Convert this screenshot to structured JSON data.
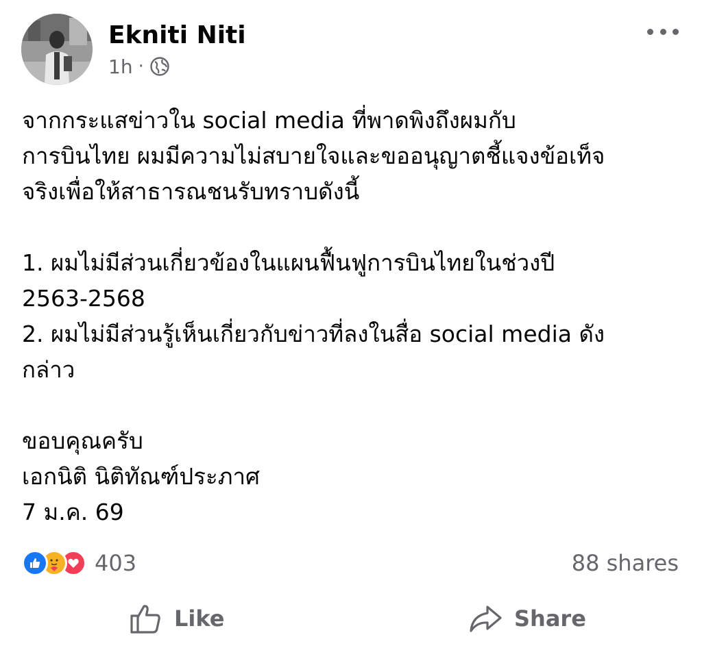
{
  "post": {
    "author": "Ekniti Niti",
    "time": "1h",
    "separator": "·",
    "privacy_icon": "globe-icon",
    "more_icon": "more-icon",
    "body": {
      "para1": "จากกระแสข่าวใน social media ที่พาดพิงถึงผมกับ\nการบินไทย ผมมีความไม่สบายใจและขออนุญาตชี้แจงข้อเท็จ\nจริงเพื่อให้สาธารณชนรับทราบดังนี้",
      "item1": "1. ผมไม่มีส่วนเกี่ยวข้องในแผนฟื้นฟูการบินไทยในช่วงปี\n2563-2568",
      "item2": "2. ผมไม่มีส่วนรู้เห็นเกี่ยวกับข่าวที่ลงในสื่อ social media ดัง\nกล่าว",
      "thanks": "ขอบคุณครับ",
      "signature": "เอกนิติ นิติทัณฑ์ประภาศ",
      "date": "7 ม.ค. 69"
    }
  },
  "stats": {
    "reaction_icons": [
      "like-reaction-icon",
      "care-reaction-icon",
      "love-reaction-icon"
    ],
    "reaction_count": "403",
    "shares": "88 shares"
  },
  "actions": {
    "like_label": "Like",
    "share_label": "Share"
  },
  "colors": {
    "text": "#050505",
    "secondary": "#65676b",
    "like_blue": "#1877f2",
    "care_yellow": "#f7b125",
    "love_red": "#f33e58"
  }
}
